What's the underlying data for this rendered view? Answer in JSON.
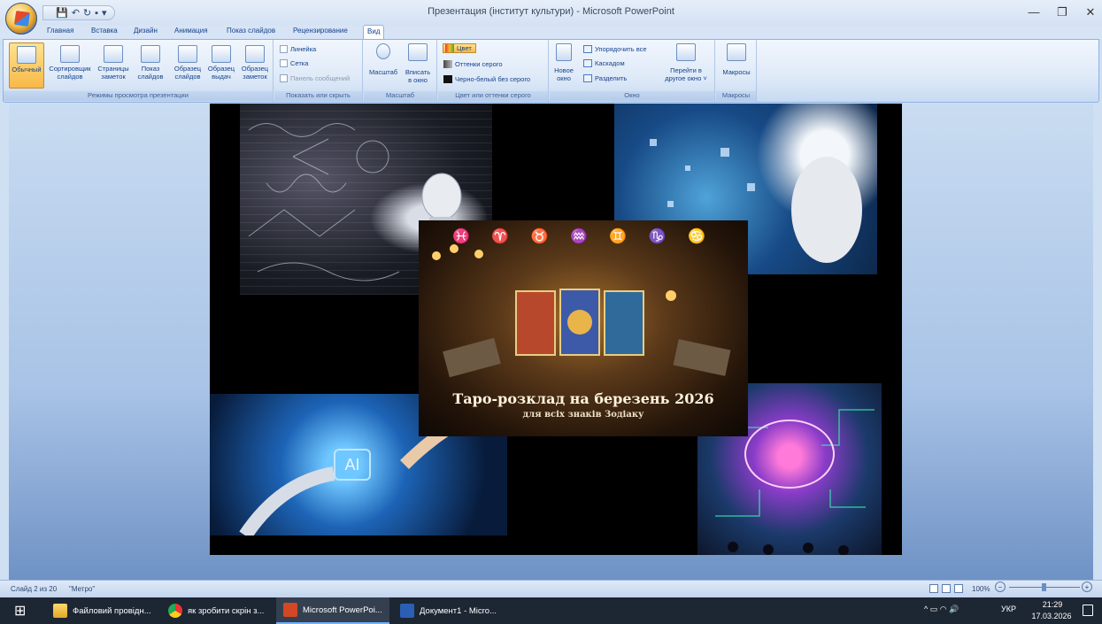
{
  "window": {
    "title": "Презентация (інститут культури) - Microsoft PowerPoint",
    "minimize": "—",
    "maximize": "❐",
    "close": "✕"
  },
  "qat": {
    "save": "💾",
    "undo": "↶",
    "redo": "↻",
    "extra": "▪",
    "dropdown": "▾"
  },
  "tabs": [
    "Главная",
    "Вставка",
    "Дизайн",
    "Анимация",
    "Показ слайдов",
    "Рецензирование",
    "Вид"
  ],
  "ribbon": {
    "group1": {
      "label": "Режимы просмотра презентации",
      "b1": "Обычный",
      "b2a": "Сортировщик",
      "b2b": "слайдов",
      "b3a": "Страницы",
      "b3b": "заметок",
      "b4a": "Показ",
      "b4b": "слайдов",
      "b5a": "Образец",
      "b5b": "слайдов",
      "b6a": "Образец",
      "b6b": "выдач",
      "b7a": "Образец",
      "b7b": "заметок"
    },
    "group2": {
      "label": "Показать или скрыть",
      "c1": "Линейка",
      "c2": "Сетка",
      "c3": "Панель сообщений"
    },
    "group3": {
      "label": "Масштаб",
      "b1": "Масштаб",
      "b2a": "Вписать",
      "b2b": "в окно"
    },
    "group4": {
      "label": "Цвет или оттенки серого",
      "r1": "Цвет",
      "r2": "Оттенки серого",
      "r3": "Черно-белый без серого"
    },
    "group5": {
      "label": "Окно",
      "b1a": "Новое",
      "b1b": "окно",
      "s1": "Упорядочить все",
      "s2": "Каскадом",
      "s3": "Разделить",
      "b2a": "Перейти в",
      "b2b": "другое окно ˅"
    },
    "group6": {
      "label": "Макросы",
      "b1": "Макросы"
    }
  },
  "slide": {
    "poster_title": "Таро-розклад на березень 2026",
    "poster_subtitle": "для всіх знаків Зодіаку",
    "ai_text": "AI",
    "zodiac": "♓ ♈ ♉ ♒ ♊ ♑ ♋"
  },
  "status": {
    "slide_info": "Слайд 2 из 20",
    "theme": "\"Метро\"",
    "zoom": "100%",
    "zoom_out": "−",
    "zoom_in": "+"
  },
  "taskbar": {
    "start": "⊞",
    "apps": [
      "Файловий провідн...",
      "як зробити скрін з...",
      "Microsoft PowerPoi...",
      "Документ1 - Micro..."
    ],
    "lang": "УКР",
    "time": "21:29",
    "date": "17.03.2026",
    "tray_icons": "^  ▭  ◠  🔊"
  },
  "colors": {
    "ribbon_text": "#15428b",
    "active_button": "#f9b847",
    "taskbar": "#1d2633"
  }
}
